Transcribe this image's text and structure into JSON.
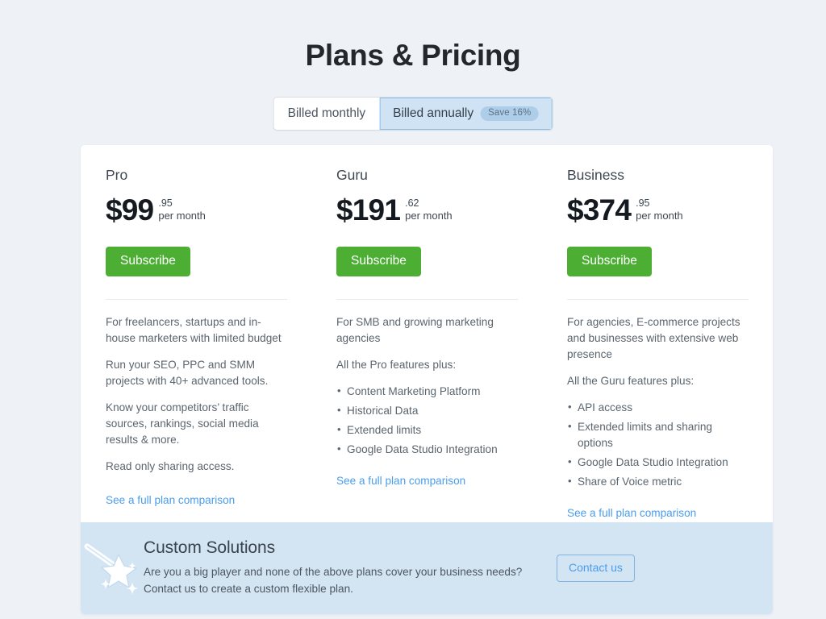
{
  "page": {
    "title": "Plans & Pricing",
    "background_color": "#eef2f6"
  },
  "billing_toggle": {
    "options": [
      {
        "label": "Billed monthly",
        "active": false,
        "badge": null
      },
      {
        "label": "Billed annually",
        "active": true,
        "badge": "Save 16%"
      }
    ],
    "active_color": "#cfe3f5",
    "badge_color": "#aecde9"
  },
  "plans": [
    {
      "name": "Pro",
      "price_major": "$99",
      "price_cents": ".95",
      "price_period": "per month",
      "button_label": "Subscribe",
      "button_color": "#4caf34",
      "paragraphs": [
        "For freelancers, startups and in-house marketers with limited budget",
        "Run your SEO, PPC and SMM projects with 40+ advanced tools.",
        "Know your competitors’ traffic sources, rankings, social media results & more.",
        "Read only sharing access."
      ],
      "features_intro": null,
      "features": [],
      "link_label": "See a full plan comparison"
    },
    {
      "name": "Guru",
      "price_major": "$191",
      "price_cents": ".62",
      "price_period": "per month",
      "button_label": "Subscribe",
      "button_color": "#4caf34",
      "paragraphs": [
        "For SMB and growing marketing agencies"
      ],
      "features_intro": "All the Pro features plus:",
      "features": [
        "Content Marketing Platform",
        "Historical Data",
        "Extended limits",
        "Google Data Studio Integration"
      ],
      "link_label": "See a full plan comparison"
    },
    {
      "name": "Business",
      "price_major": "$374",
      "price_cents": ".95",
      "price_period": "per month",
      "button_label": "Subscribe",
      "button_color": "#4caf34",
      "paragraphs": [
        "For agencies, E-commerce projects and businesses with extensive web presence"
      ],
      "features_intro": "All the Guru features plus:",
      "features": [
        "API access",
        "Extended limits and sharing options",
        "Google Data Studio Integration",
        "Share of Voice metric"
      ],
      "link_label": "See a full plan comparison"
    }
  ],
  "custom_solutions": {
    "icon": "magic-wand-icon",
    "title": "Custom Solutions",
    "description": "Are you a big player and none of the above plans cover your business needs? Contact us to create a custom flexible plan.",
    "button_label": "Contact us",
    "band_color": "#d3e4f3",
    "link_color": "#4a9ded"
  }
}
